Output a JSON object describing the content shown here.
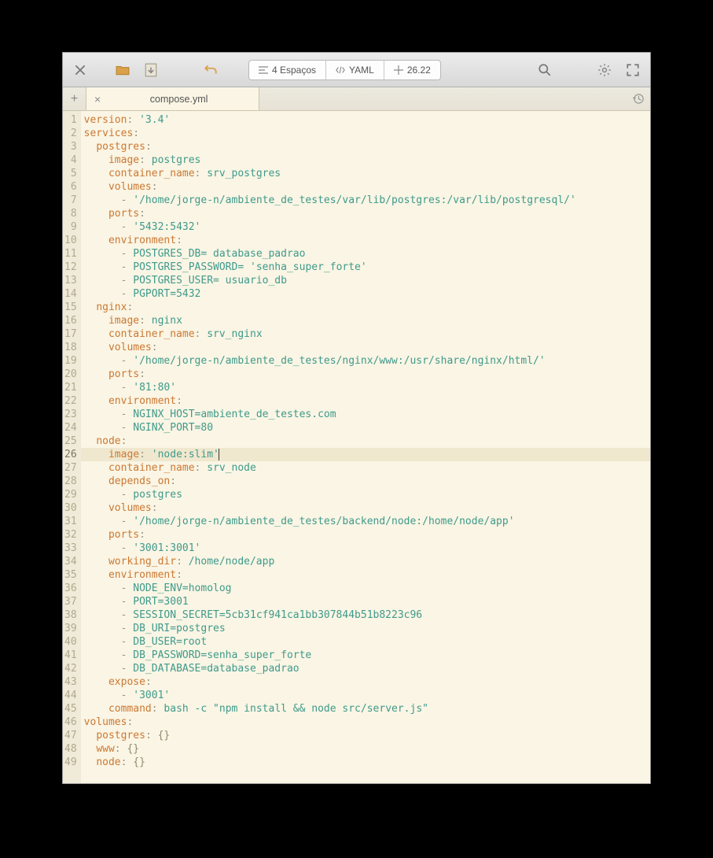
{
  "toolbar": {
    "indent_label": "4 Espaços",
    "syntax_label": "YAML",
    "position_label": "26.22"
  },
  "tab": {
    "filename": "compose.yml"
  },
  "editor": {
    "current_line": 26,
    "lines": [
      {
        "n": 1,
        "segs": [
          [
            "k",
            "version"
          ],
          [
            "c",
            ":"
          ],
          [
            "c",
            " "
          ],
          [
            "s",
            "'3.4'"
          ]
        ]
      },
      {
        "n": 2,
        "segs": [
          [
            "k",
            "services"
          ],
          [
            "c",
            ":"
          ]
        ]
      },
      {
        "n": 3,
        "segs": [
          [
            "c",
            "  "
          ],
          [
            "k",
            "postgres"
          ],
          [
            "c",
            ":"
          ]
        ]
      },
      {
        "n": 4,
        "segs": [
          [
            "c",
            "    "
          ],
          [
            "k",
            "image"
          ],
          [
            "c",
            ":"
          ],
          [
            "c",
            " "
          ],
          [
            "v",
            "postgres"
          ]
        ]
      },
      {
        "n": 5,
        "segs": [
          [
            "c",
            "    "
          ],
          [
            "k",
            "container_name"
          ],
          [
            "c",
            ":"
          ],
          [
            "c",
            " "
          ],
          [
            "v",
            "srv_postgres"
          ]
        ]
      },
      {
        "n": 6,
        "segs": [
          [
            "c",
            "    "
          ],
          [
            "k",
            "volumes"
          ],
          [
            "c",
            ":"
          ]
        ]
      },
      {
        "n": 7,
        "segs": [
          [
            "c",
            "      "
          ],
          [
            "c",
            "- "
          ],
          [
            "s",
            "'/home/jorge-n/ambiente_de_testes/var/lib/postgres:/var/lib/postgresql/'"
          ]
        ]
      },
      {
        "n": 8,
        "segs": [
          [
            "c",
            "    "
          ],
          [
            "k",
            "ports"
          ],
          [
            "c",
            ":"
          ]
        ]
      },
      {
        "n": 9,
        "segs": [
          [
            "c",
            "      "
          ],
          [
            "c",
            "- "
          ],
          [
            "s",
            "'5432:5432'"
          ]
        ]
      },
      {
        "n": 10,
        "segs": [
          [
            "c",
            "    "
          ],
          [
            "k",
            "environment"
          ],
          [
            "c",
            ":"
          ]
        ]
      },
      {
        "n": 11,
        "segs": [
          [
            "c",
            "      "
          ],
          [
            "c",
            "- "
          ],
          [
            "v",
            "POSTGRES_DB= database_padrao"
          ]
        ]
      },
      {
        "n": 12,
        "segs": [
          [
            "c",
            "      "
          ],
          [
            "c",
            "- "
          ],
          [
            "v",
            "POSTGRES_PASSWORD= "
          ],
          [
            "s",
            "'senha_super_forte'"
          ]
        ]
      },
      {
        "n": 13,
        "segs": [
          [
            "c",
            "      "
          ],
          [
            "c",
            "- "
          ],
          [
            "v",
            "POSTGRES_USER= usuario_db"
          ]
        ]
      },
      {
        "n": 14,
        "segs": [
          [
            "c",
            "      "
          ],
          [
            "c",
            "- "
          ],
          [
            "v",
            "PGPORT=5432"
          ]
        ]
      },
      {
        "n": 15,
        "segs": [
          [
            "c",
            "  "
          ],
          [
            "k",
            "nginx"
          ],
          [
            "c",
            ":"
          ]
        ]
      },
      {
        "n": 16,
        "segs": [
          [
            "c",
            "    "
          ],
          [
            "k",
            "image"
          ],
          [
            "c",
            ":"
          ],
          [
            "c",
            " "
          ],
          [
            "v",
            "nginx"
          ]
        ]
      },
      {
        "n": 17,
        "segs": [
          [
            "c",
            "    "
          ],
          [
            "k",
            "container_name"
          ],
          [
            "c",
            ":"
          ],
          [
            "c",
            " "
          ],
          [
            "v",
            "srv_nginx"
          ]
        ]
      },
      {
        "n": 18,
        "segs": [
          [
            "c",
            "    "
          ],
          [
            "k",
            "volumes"
          ],
          [
            "c",
            ":"
          ]
        ]
      },
      {
        "n": 19,
        "segs": [
          [
            "c",
            "      "
          ],
          [
            "c",
            "- "
          ],
          [
            "s",
            "'/home/jorge-n/ambiente_de_testes/nginx/www:/usr/share/nginx/html/'"
          ]
        ]
      },
      {
        "n": 20,
        "segs": [
          [
            "c",
            "    "
          ],
          [
            "k",
            "ports"
          ],
          [
            "c",
            ":"
          ]
        ]
      },
      {
        "n": 21,
        "segs": [
          [
            "c",
            "      "
          ],
          [
            "c",
            "- "
          ],
          [
            "s",
            "'81:80'"
          ]
        ]
      },
      {
        "n": 22,
        "segs": [
          [
            "c",
            "    "
          ],
          [
            "k",
            "environment"
          ],
          [
            "c",
            ":"
          ]
        ]
      },
      {
        "n": 23,
        "segs": [
          [
            "c",
            "      "
          ],
          [
            "c",
            "- "
          ],
          [
            "v",
            "NGINX_HOST=ambiente_de_testes.com"
          ]
        ]
      },
      {
        "n": 24,
        "segs": [
          [
            "c",
            "      "
          ],
          [
            "c",
            "- "
          ],
          [
            "v",
            "NGINX_PORT=80"
          ]
        ]
      },
      {
        "n": 25,
        "segs": [
          [
            "c",
            "  "
          ],
          [
            "k",
            "node"
          ],
          [
            "c",
            ":"
          ]
        ]
      },
      {
        "n": 26,
        "segs": [
          [
            "c",
            "    "
          ],
          [
            "k",
            "image"
          ],
          [
            "c",
            ":"
          ],
          [
            "c",
            " "
          ],
          [
            "s",
            "'node:slim'"
          ]
        ]
      },
      {
        "n": 27,
        "segs": [
          [
            "c",
            "    "
          ],
          [
            "k",
            "container_name"
          ],
          [
            "c",
            ":"
          ],
          [
            "c",
            " "
          ],
          [
            "v",
            "srv_node"
          ]
        ]
      },
      {
        "n": 28,
        "segs": [
          [
            "c",
            "    "
          ],
          [
            "k",
            "depends_on"
          ],
          [
            "c",
            ":"
          ]
        ]
      },
      {
        "n": 29,
        "segs": [
          [
            "c",
            "      "
          ],
          [
            "c",
            "- "
          ],
          [
            "v",
            "postgres"
          ]
        ]
      },
      {
        "n": 30,
        "segs": [
          [
            "c",
            "    "
          ],
          [
            "k",
            "volumes"
          ],
          [
            "c",
            ":"
          ]
        ]
      },
      {
        "n": 31,
        "segs": [
          [
            "c",
            "      "
          ],
          [
            "c",
            "- "
          ],
          [
            "s",
            "'/home/jorge-n/ambiente_de_testes/backend/node:/home/node/app'"
          ]
        ]
      },
      {
        "n": 32,
        "segs": [
          [
            "c",
            "    "
          ],
          [
            "k",
            "ports"
          ],
          [
            "c",
            ":"
          ]
        ]
      },
      {
        "n": 33,
        "segs": [
          [
            "c",
            "      "
          ],
          [
            "c",
            "- "
          ],
          [
            "s",
            "'3001:3001'"
          ]
        ]
      },
      {
        "n": 34,
        "segs": [
          [
            "c",
            "    "
          ],
          [
            "k",
            "working_dir"
          ],
          [
            "c",
            ":"
          ],
          [
            "c",
            " "
          ],
          [
            "v",
            "/home/node/app"
          ]
        ]
      },
      {
        "n": 35,
        "segs": [
          [
            "c",
            "    "
          ],
          [
            "k",
            "environment"
          ],
          [
            "c",
            ":"
          ]
        ]
      },
      {
        "n": 36,
        "segs": [
          [
            "c",
            "      "
          ],
          [
            "c",
            "- "
          ],
          [
            "v",
            "NODE_ENV=homolog"
          ]
        ]
      },
      {
        "n": 37,
        "segs": [
          [
            "c",
            "      "
          ],
          [
            "c",
            "- "
          ],
          [
            "v",
            "PORT=3001"
          ]
        ]
      },
      {
        "n": 38,
        "segs": [
          [
            "c",
            "      "
          ],
          [
            "c",
            "- "
          ],
          [
            "v",
            "SESSION_SECRET=5cb31cf941ca1bb307844b51b8223c96"
          ]
        ]
      },
      {
        "n": 39,
        "segs": [
          [
            "c",
            "      "
          ],
          [
            "c",
            "- "
          ],
          [
            "v",
            "DB_URI=postgres"
          ]
        ]
      },
      {
        "n": 40,
        "segs": [
          [
            "c",
            "      "
          ],
          [
            "c",
            "- "
          ],
          [
            "v",
            "DB_USER=root"
          ]
        ]
      },
      {
        "n": 41,
        "segs": [
          [
            "c",
            "      "
          ],
          [
            "c",
            "- "
          ],
          [
            "v",
            "DB_PASSWORD=senha_super_forte"
          ]
        ]
      },
      {
        "n": 42,
        "segs": [
          [
            "c",
            "      "
          ],
          [
            "c",
            "- "
          ],
          [
            "v",
            "DB_DATABASE=database_padrao"
          ]
        ]
      },
      {
        "n": 43,
        "segs": [
          [
            "c",
            "    "
          ],
          [
            "k",
            "expose"
          ],
          [
            "c",
            ":"
          ]
        ]
      },
      {
        "n": 44,
        "segs": [
          [
            "c",
            "      "
          ],
          [
            "c",
            "- "
          ],
          [
            "s",
            "'3001'"
          ]
        ]
      },
      {
        "n": 45,
        "segs": [
          [
            "c",
            "    "
          ],
          [
            "k",
            "command"
          ],
          [
            "c",
            ":"
          ],
          [
            "c",
            " "
          ],
          [
            "v",
            "bash -c "
          ],
          [
            "s",
            "\"npm install && node src/server.js\""
          ]
        ]
      },
      {
        "n": 46,
        "segs": [
          [
            "k",
            "volumes"
          ],
          [
            "c",
            ":"
          ]
        ]
      },
      {
        "n": 47,
        "segs": [
          [
            "c",
            "  "
          ],
          [
            "k",
            "postgres"
          ],
          [
            "c",
            ":"
          ],
          [
            "c",
            " "
          ],
          [
            "b",
            "{}"
          ]
        ]
      },
      {
        "n": 48,
        "segs": [
          [
            "c",
            "  "
          ],
          [
            "k",
            "www"
          ],
          [
            "c",
            ":"
          ],
          [
            "c",
            " "
          ],
          [
            "b",
            "{}"
          ]
        ]
      },
      {
        "n": 49,
        "segs": [
          [
            "c",
            "  "
          ],
          [
            "k",
            "node"
          ],
          [
            "c",
            ":"
          ],
          [
            "c",
            " "
          ],
          [
            "b",
            "{}"
          ]
        ]
      }
    ]
  }
}
